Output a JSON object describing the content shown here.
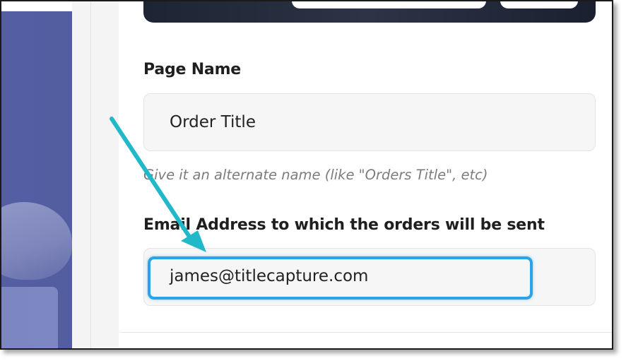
{
  "form": {
    "page_name_label": "Page Name",
    "page_name_value": "Order Title",
    "page_name_hint": "Give it an alternate name (like \"Orders Title\", etc)",
    "email_label": "Email Address to which the orders will be sent",
    "email_value": "james@titlecapture.com"
  },
  "annotation": {
    "arrow_color": "#21b8c9",
    "highlight_color": "#2aa3e8"
  }
}
